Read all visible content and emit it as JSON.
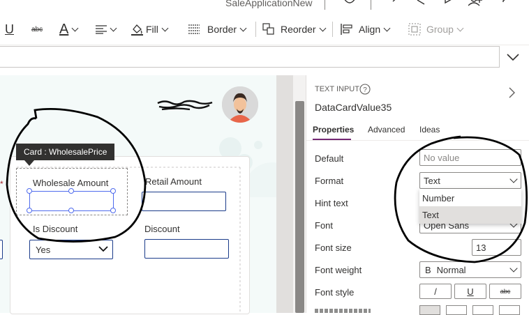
{
  "app": {
    "title": "SaleApplicationNew"
  },
  "ribbon": {
    "underline_label": "U",
    "strikethrough_label": "abc",
    "font_color_label": "A",
    "fill_label": "Fill",
    "border_label": "Border",
    "reorder_label": "Reorder",
    "align_label": "Align",
    "group_label": "Group"
  },
  "canvas": {
    "tooltip": "Card : WholesalePrice",
    "fields": {
      "wholesale_label": "Wholesale Amount",
      "retail_label": "Retail Amount",
      "is_discount_label": "Is Discount",
      "is_discount_value": "Yes",
      "discount_label": "Discount"
    }
  },
  "pane": {
    "control_type": "TEXT INPUT",
    "control_name": "DataCardValue35",
    "tabs": [
      "Properties",
      "Advanced",
      "Ideas"
    ],
    "active_tab": "Properties",
    "properties": {
      "default_label": "Default",
      "default_placeholder": "No value",
      "format_label": "Format",
      "format_value": "Text",
      "format_options": [
        "Number",
        "Text"
      ],
      "hint_label": "Hint text",
      "font_label": "Font",
      "font_value": "Open Sans",
      "font_size_label": "Font size",
      "font_size_value": "13",
      "font_weight_label": "Font weight",
      "font_weight_prefix": "B",
      "font_weight_value": "Normal",
      "font_style_label": "Font style",
      "italic_label": "/",
      "underline_label": "U",
      "strike_label": "abc"
    }
  },
  "colors": {
    "accent": "#4f6bed",
    "tab_underline": "#742774",
    "input_border": "#1a3b8a",
    "annotation": "#000000"
  }
}
